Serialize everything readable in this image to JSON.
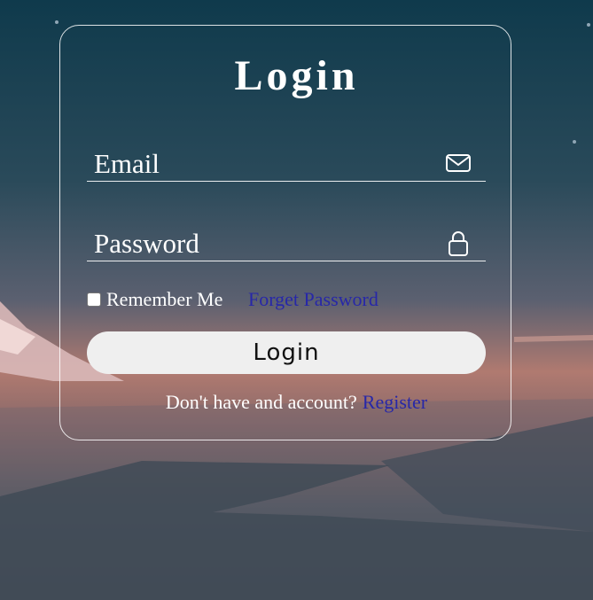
{
  "form": {
    "title": "Login",
    "email_placeholder": "Email",
    "password_placeholder": "Password",
    "remember_label": "Remember Me",
    "remember_checked": false,
    "forgot_label": "Forget Password",
    "login_button_label": "Login",
    "register_prompt": "Don't have and account?",
    "register_link": "Register"
  },
  "icons": {
    "email": "envelope-icon",
    "password": "lock-icon"
  },
  "colors": {
    "link": "#2727a8",
    "text": "#ffffff",
    "button_bg": "#efefef"
  }
}
